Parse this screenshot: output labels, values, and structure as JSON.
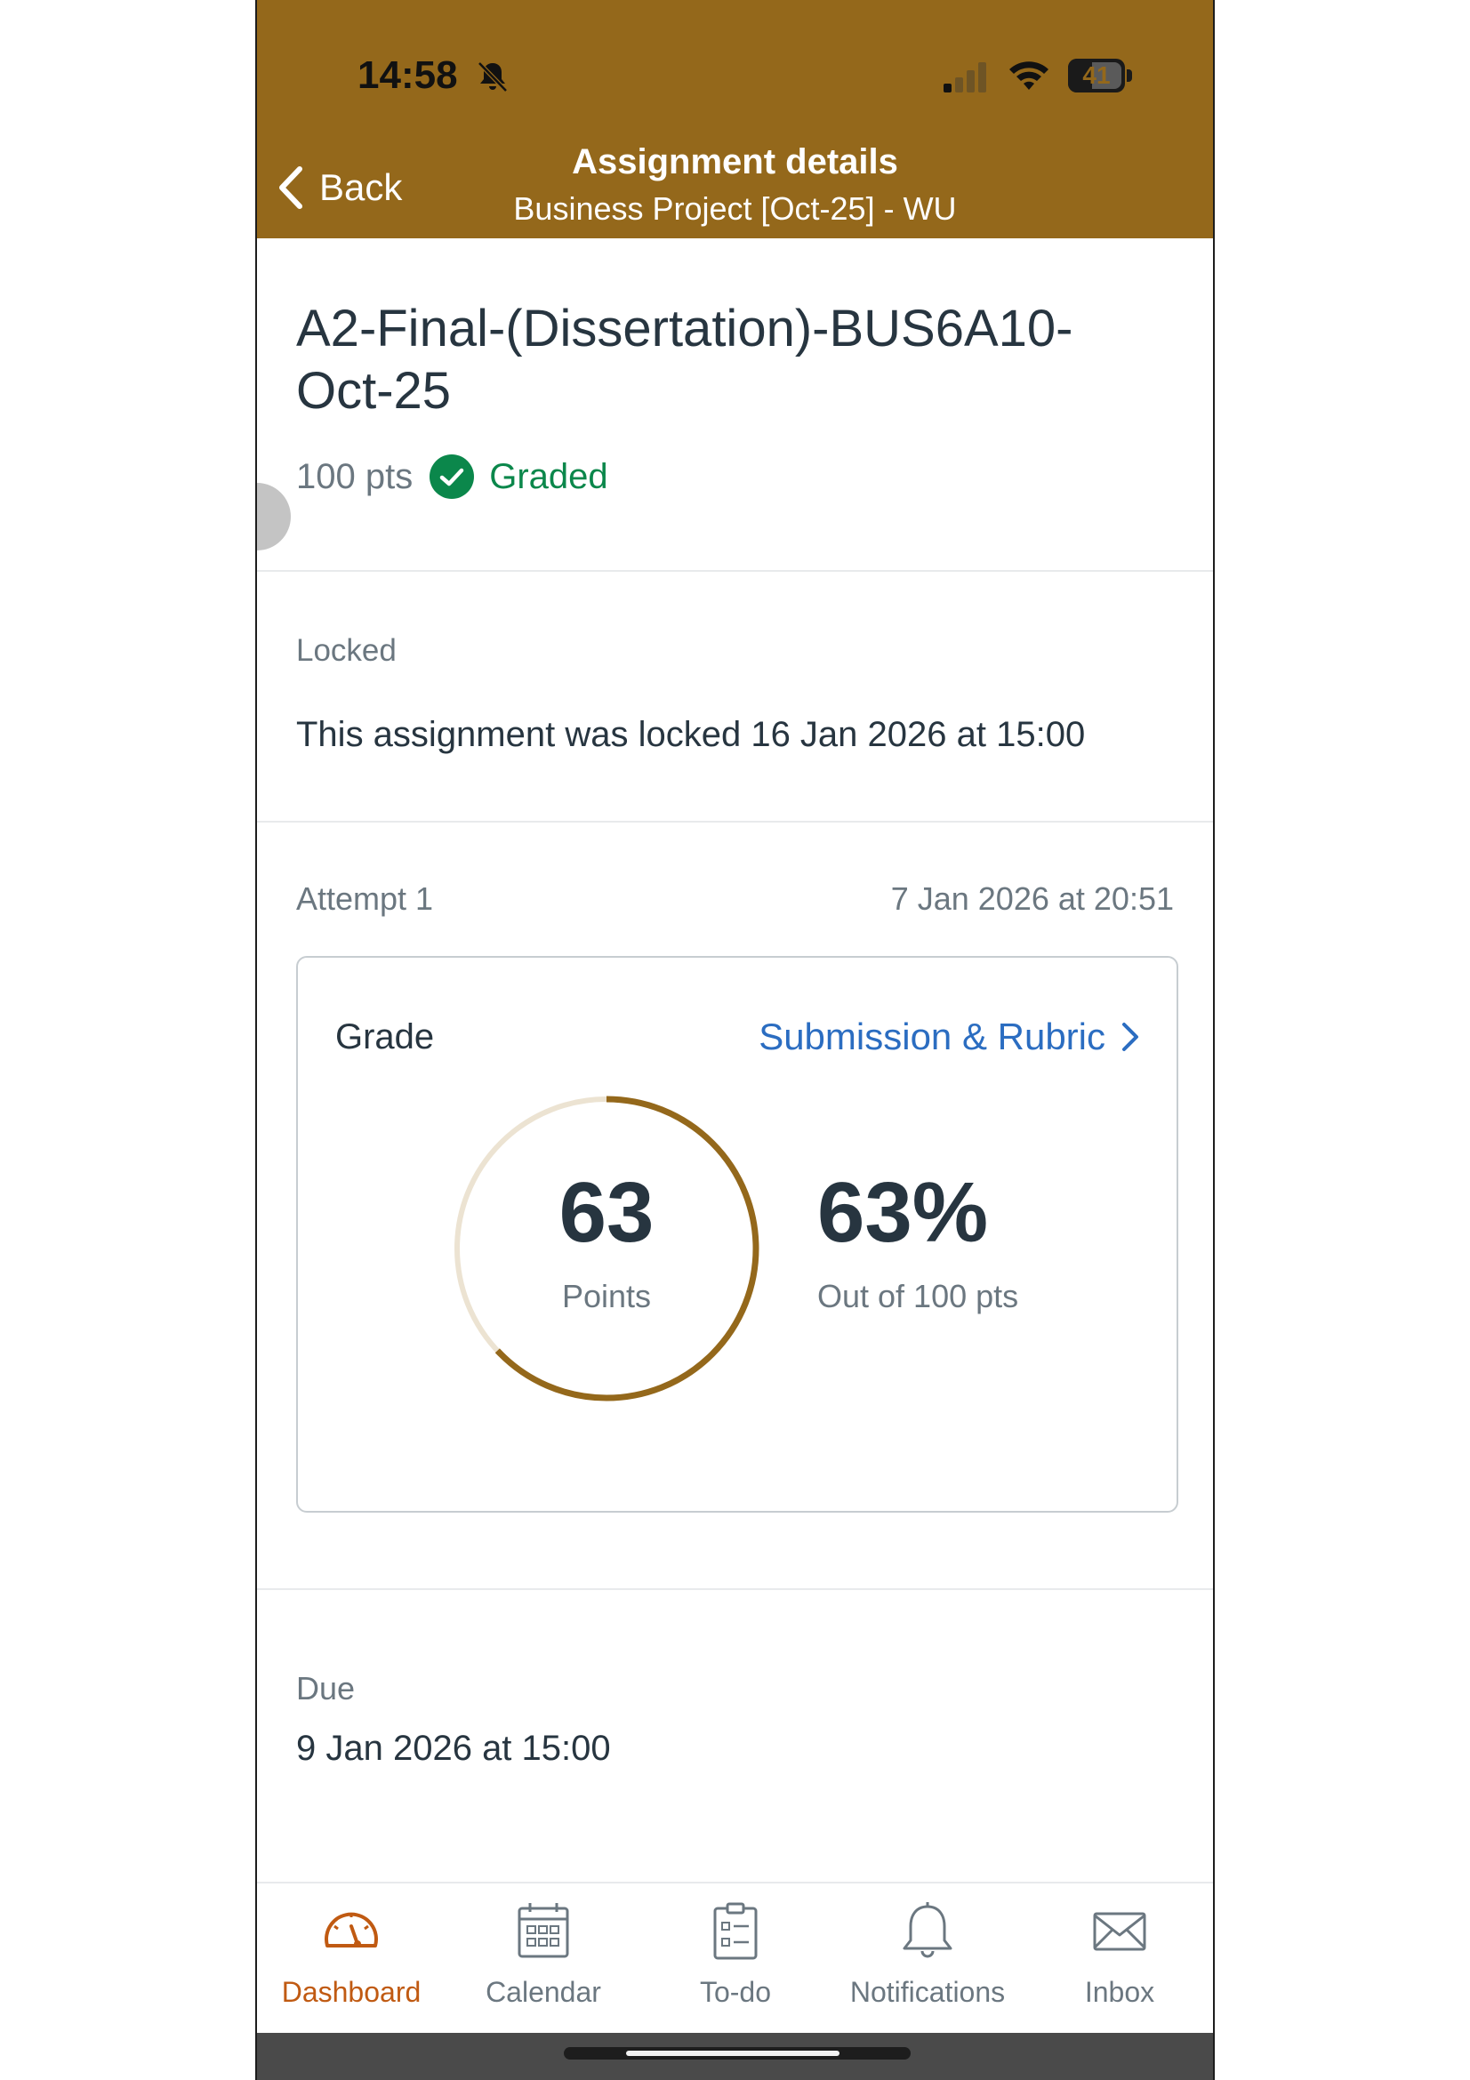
{
  "status_bar": {
    "time": "14:58",
    "battery": "41"
  },
  "header": {
    "back_label": "Back",
    "title": "Assignment details",
    "subtitle": "Business Project [Oct-25] - WU"
  },
  "assignment": {
    "title": "A2-Final-(Dissertation)-BUS6A10-Oct-25",
    "points_possible": "100 pts",
    "status": "Graded",
    "locked_label": "Locked",
    "locked_text": "This assignment was locked 16 Jan 2026 at 15:00"
  },
  "attempt": {
    "label": "Attempt 1",
    "date": "7 Jan 2026 at 20:51"
  },
  "grade": {
    "label": "Grade",
    "link_label": "Submission & Rubric",
    "score": "63",
    "score_unit": "Points",
    "percent": "63%",
    "out_of": "Out of 100 pts",
    "fraction": 0.63
  },
  "due": {
    "label": "Due",
    "value": "9 Jan 2026 at 15:00"
  },
  "tabs": [
    {
      "label": "Dashboard",
      "icon": "dashboard-icon",
      "active": true
    },
    {
      "label": "Calendar",
      "icon": "calendar-icon",
      "active": false
    },
    {
      "label": "To-do",
      "icon": "todo-icon",
      "active": false
    },
    {
      "label": "Notifications",
      "icon": "bell-icon",
      "active": false
    },
    {
      "label": "Inbox",
      "icon": "inbox-icon",
      "active": false
    }
  ],
  "colors": {
    "brand": "#94681b",
    "graded": "#0b874b",
    "link": "#2b6dc1",
    "active_tab": "#c05a12",
    "ring_track": "#ece3d2"
  }
}
